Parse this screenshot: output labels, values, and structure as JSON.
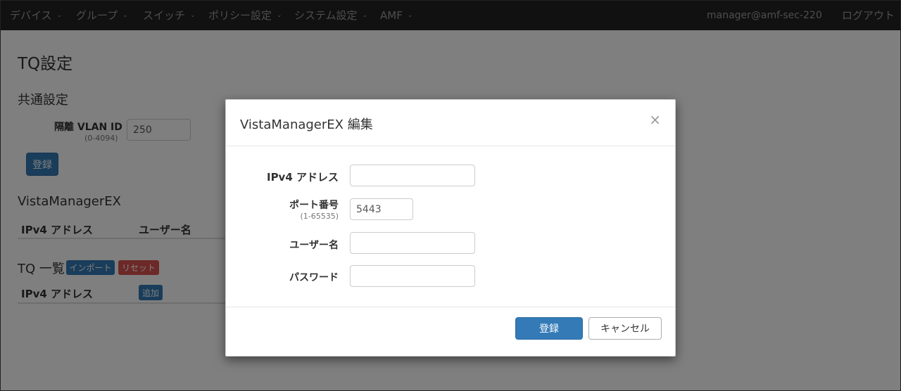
{
  "nav": {
    "items": [
      {
        "label": "デバイス"
      },
      {
        "label": "グループ"
      },
      {
        "label": "スイッチ"
      },
      {
        "label": "ポリシー設定"
      },
      {
        "label": "システム設定"
      },
      {
        "label": "AMF"
      }
    ],
    "user": "manager@amf-sec-220",
    "logout": "ログアウト",
    "caret": "⌄"
  },
  "page": {
    "title": "TQ設定",
    "common_section": "共通設定",
    "vlan_label": "隔離 VLAN ID",
    "vlan_range": "(0-4094)",
    "vlan_value": "250",
    "register_button": "登録",
    "vme_section": "VistaManagerEX",
    "vme_headers": [
      "IPv4 アドレス",
      "ユーザー名"
    ],
    "tq_section": "TQ 一覧",
    "import_button": "インポート",
    "reset_button": "リセット",
    "tq_header_ip": "IPv4 アドレス",
    "add_button": "追加"
  },
  "modal": {
    "title": "VistaManagerEX 編集",
    "close": "×",
    "ip_label": "IPv4 アドレス",
    "ip_value": "",
    "port_label": "ポート番号",
    "port_range": "(1-65535)",
    "port_value": "5443",
    "user_label": "ユーザー名",
    "user_value": "",
    "password_label": "パスワード",
    "password_value": "",
    "submit_button": "登録",
    "cancel_button": "キャンセル"
  },
  "colors": {
    "navbar": "#222222",
    "primary": "#337ab7",
    "danger": "#d9534f",
    "backdrop": "rgba(0,0,0,0.5)"
  }
}
